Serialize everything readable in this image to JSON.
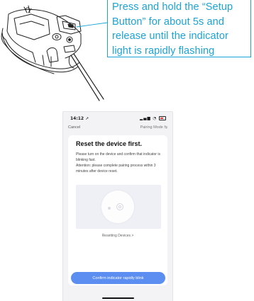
{
  "callout": {
    "lines": [
      "Press and hold the “Setup",
      "Button” for about  5s and",
      "release until the indicator",
      "light is rapidly flashing"
    ],
    "color": "#1ba3d8"
  },
  "status_bar": {
    "time": "14:12",
    "location_icon": "location-arrow-icon",
    "signal_icon": "signal-icon",
    "wifi_icon": "wifi-icon",
    "battery_icon": "battery-icon"
  },
  "nav": {
    "cancel_label": "Cancel",
    "mode_label": "Pairing Mode ⇆"
  },
  "card": {
    "title": "Reset the device first.",
    "desc_1": "Please turn on the device and confirm that indicator is blinking fast.",
    "desc_2": "Attention: please complete pairing process within 3 minutes after device reset.",
    "resetting_link": "Resetting Devices >",
    "confirm_label": "Confirm indicator rapidly blink"
  },
  "colors": {
    "accent": "#5b8ef0",
    "card_bg": "#ffffff",
    "screen_bg": "#f3f3f6"
  }
}
